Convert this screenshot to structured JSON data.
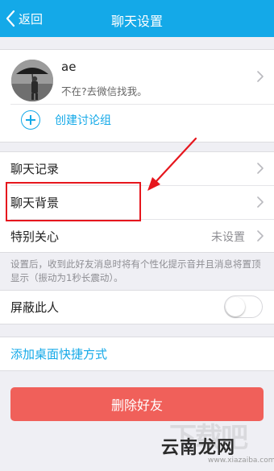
{
  "nav": {
    "back_label": "返回",
    "title": "聊天设置"
  },
  "contact": {
    "name": "ae",
    "status": "不在?去微信找我。"
  },
  "create_group_label": "创建讨论组",
  "rows": {
    "chat_history": "聊天记录",
    "chat_background": "聊天背景",
    "special_care": "特别关心",
    "special_care_value": "未设置"
  },
  "hint": "设置后，收到此好友消息时将有个性化提示音并且消息将置顶显示（振动为1秒长震动）。",
  "block": {
    "label": "屏蔽此人",
    "enabled": false
  },
  "add_shortcut_label": "添加桌面快捷方式",
  "delete_label": "删除好友",
  "watermark": {
    "text": "云南龙网",
    "sub": "www.xiazaiba.com"
  },
  "colors": {
    "accent": "#14a9e8",
    "danger": "#f0605a",
    "annotation": "#e6161d"
  }
}
